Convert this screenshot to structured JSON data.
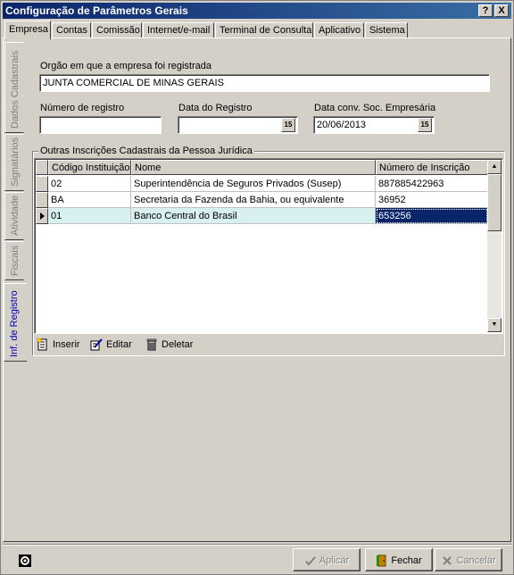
{
  "window": {
    "title": "Configuração de Parâmetros Gerais",
    "help_btn": "?",
    "close_btn": "X"
  },
  "top_tabs": [
    "Empresa",
    "Contas",
    "Comissão",
    "Internet/e-mail",
    "Terminal de Consulta",
    "Aplicativo",
    "Sistema"
  ],
  "side_tabs": [
    "Dados Cadastrais",
    "Signatários",
    "Atividade",
    "Fiscais",
    "Inf. de Registro"
  ],
  "form": {
    "orgao_label": "Orgão em que a empresa foi registrada",
    "orgao_value": "JUNTA COMERCIAL DE MINAS GERAIS",
    "numero_label": "Número de registro",
    "numero_value": "",
    "data_registro_label": "Data do Registro",
    "data_registro_value": "",
    "data_conv_label": "Data conv. Soc. Empresária",
    "data_conv_value": "20/06/2013",
    "cal_icon_text": "15"
  },
  "group": {
    "title": "Outras Inscrições Cadastrais da Pessoa Jurídica",
    "columns": [
      "Código Instituição",
      "Nome",
      "Número de Inscrição"
    ],
    "rows": [
      {
        "codigo": "02",
        "nome": "Superintendência de Seguros Privados (Susep)",
        "numero": "887885422963"
      },
      {
        "codigo": "BA",
        "nome": "Secretaria da Fazenda da Bahia, ou equivalente",
        "numero": "36952"
      },
      {
        "codigo": "01",
        "nome": "Banco Central do Brasil",
        "numero": "653256"
      }
    ],
    "toolbar": {
      "inserir": "Inserir",
      "editar": "Editar",
      "deletar": "Deletar"
    }
  },
  "buttons": {
    "aplicar": "Aplicar",
    "fechar": "Fechar",
    "cancelar": "Cancelar"
  }
}
